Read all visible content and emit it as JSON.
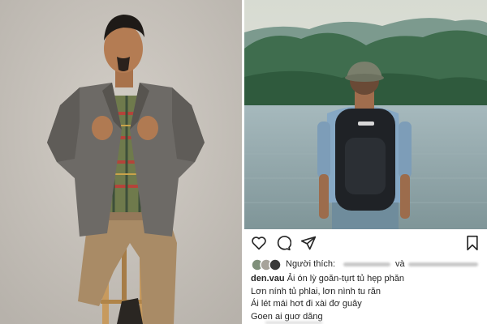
{
  "left_photo": {
    "description_icon": "person-seated-on-stool-photo"
  },
  "right_photo": {
    "description_icon": "person-with-backpack-by-lake-photo"
  },
  "instagram": {
    "icons": [
      "heart-icon",
      "comment-icon",
      "send-icon",
      "bookmark-icon"
    ],
    "likes_label": "Người thích:",
    "likes_conjunction": "và",
    "caption_username": "den.vau",
    "caption_lines": [
      " Ải ón lỳ goăn-tụrt tủ hẹp phăn",
      "Lơn nính tủ phlai, lơn nình tu răn",
      "Ái lét mái hơt đi xài đơ guây",
      "Goen ai guơ dăng"
    ]
  }
}
